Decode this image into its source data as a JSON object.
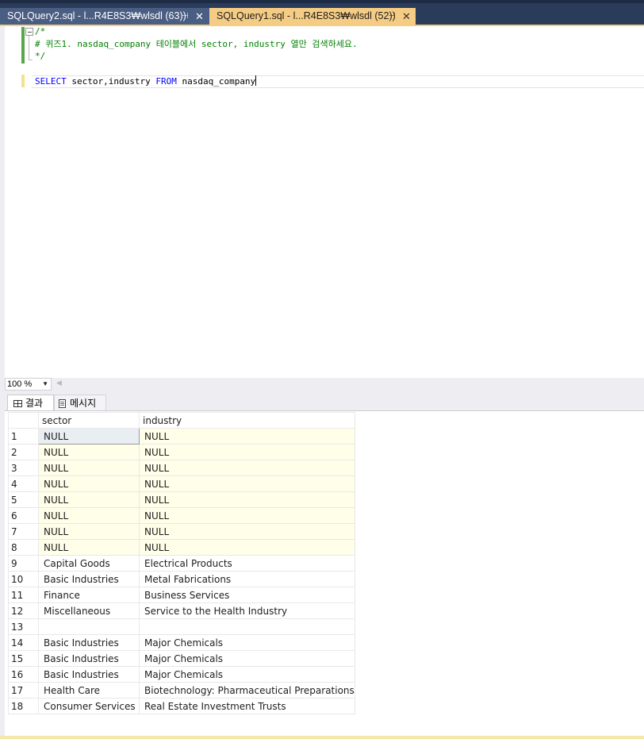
{
  "tabs": [
    {
      "label": "SQLQuery2.sql - l...R4E8S3₩wlsdl (63))",
      "active": false
    },
    {
      "label": "SQLQuery1.sql - l...R4E8S3₩wlsdl (52))",
      "active": true
    }
  ],
  "tab_pin_glyph": "⊣",
  "tab_close_glyph": "✕",
  "editor": {
    "lines": {
      "l1": "/*",
      "l2": "# 퀴즈1. nasdaq_company 테이블에서 sector, industry 열만 검색하세요.",
      "l3": "*/",
      "kw_select": "SELECT",
      "cols": " sector,industry ",
      "kw_from": "FROM",
      "table": " nasdaq_company"
    }
  },
  "zoom": {
    "value": "100 %"
  },
  "result_tabs": {
    "results": "결과",
    "messages": "메시지"
  },
  "grid": {
    "columns": [
      "sector",
      "industry"
    ],
    "rows": [
      {
        "n": "1",
        "sector": "NULL",
        "industry": "NULL"
      },
      {
        "n": "2",
        "sector": "NULL",
        "industry": "NULL"
      },
      {
        "n": "3",
        "sector": "NULL",
        "industry": "NULL"
      },
      {
        "n": "4",
        "sector": "NULL",
        "industry": "NULL"
      },
      {
        "n": "5",
        "sector": "NULL",
        "industry": "NULL"
      },
      {
        "n": "6",
        "sector": "NULL",
        "industry": "NULL"
      },
      {
        "n": "7",
        "sector": "NULL",
        "industry": "NULL"
      },
      {
        "n": "8",
        "sector": "NULL",
        "industry": "NULL"
      },
      {
        "n": "9",
        "sector": "Capital Goods",
        "industry": "Electrical Products"
      },
      {
        "n": "10",
        "sector": "Basic Industries",
        "industry": "Metal Fabrications"
      },
      {
        "n": "11",
        "sector": "Finance",
        "industry": "Business Services"
      },
      {
        "n": "12",
        "sector": "Miscellaneous",
        "industry": "Service to the Health Industry"
      },
      {
        "n": "13",
        "sector": "",
        "industry": ""
      },
      {
        "n": "14",
        "sector": "Basic Industries",
        "industry": "Major Chemicals"
      },
      {
        "n": "15",
        "sector": "Basic Industries",
        "industry": "Major Chemicals"
      },
      {
        "n": "16",
        "sector": "Basic Industries",
        "industry": "Major Chemicals"
      },
      {
        "n": "17",
        "sector": "Health Care",
        "industry": "Biotechnology: Pharmaceutical Preparations"
      },
      {
        "n": "18",
        "sector": "Consumer Services",
        "industry": "Real Estate Investment Trusts"
      }
    ]
  }
}
